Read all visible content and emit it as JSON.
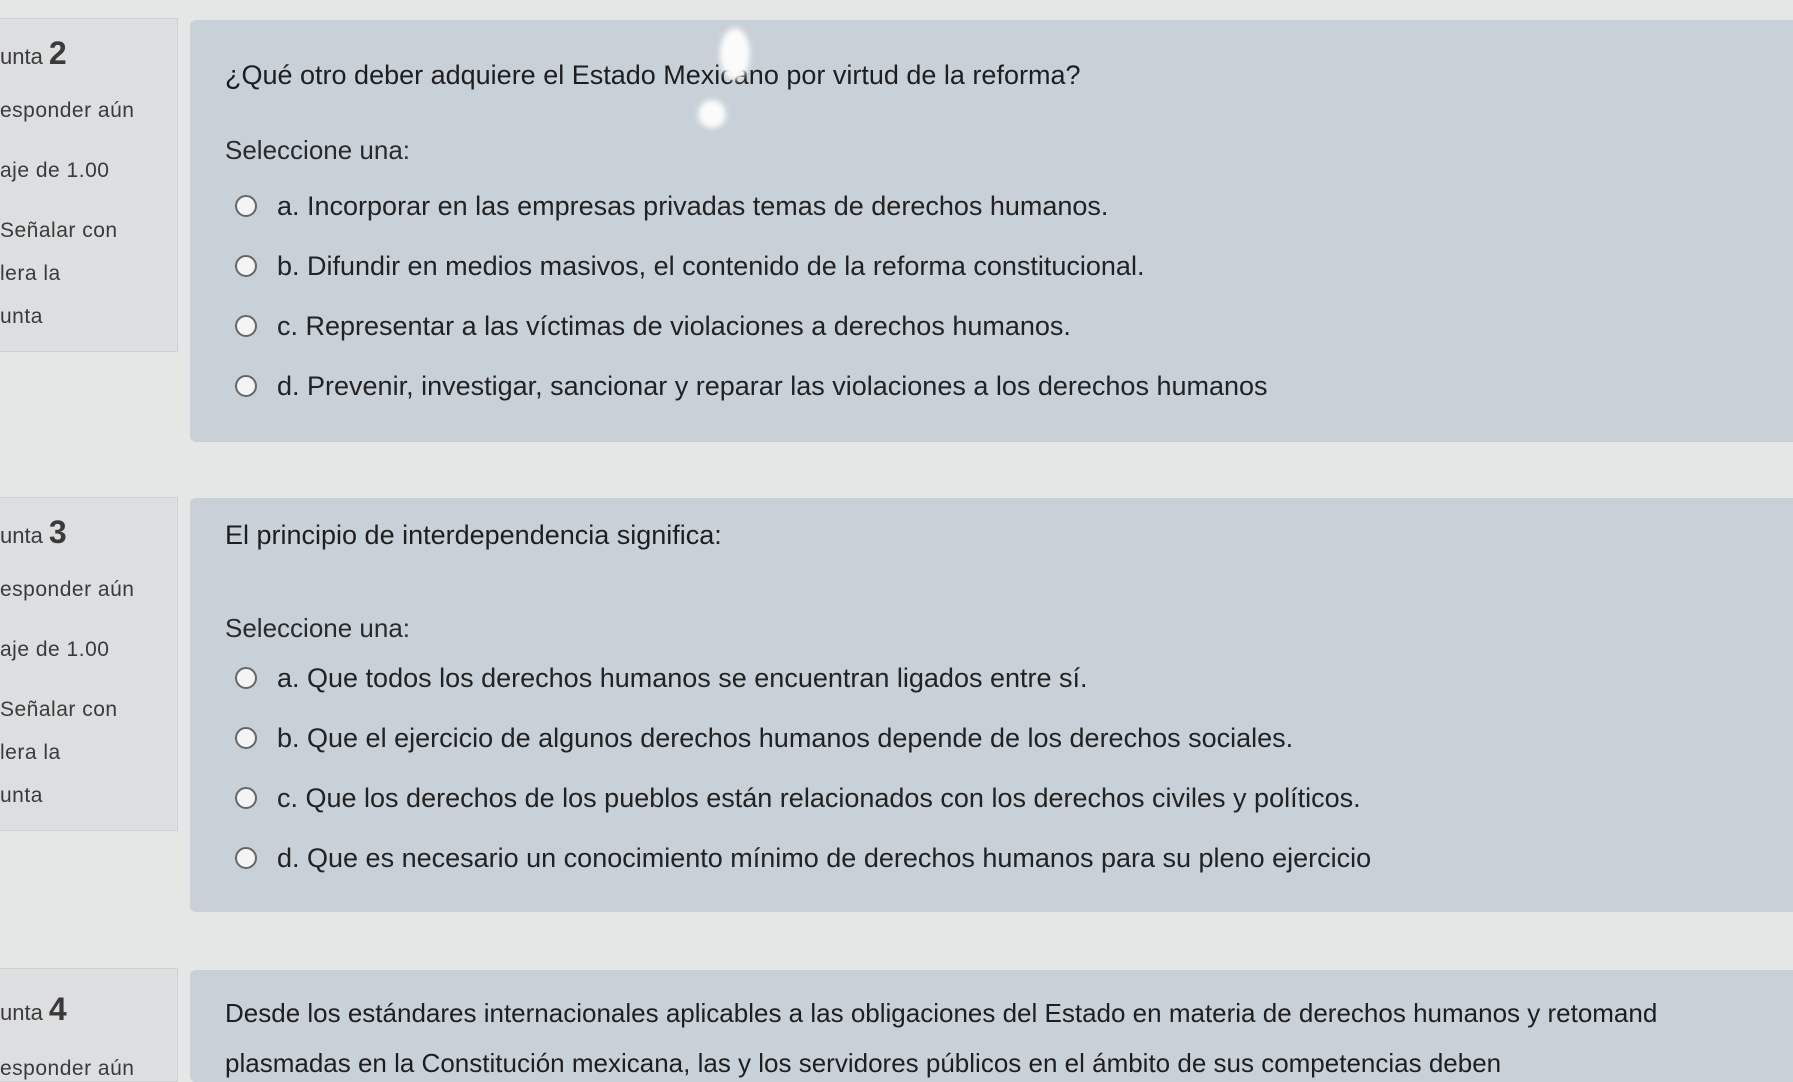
{
  "questions": [
    {
      "number_prefix": "unta",
      "number": "2",
      "status": "esponder aún",
      "grade": "aje de 1.00",
      "flag_line1": "Señalar con",
      "flag_line2": "lera la",
      "flag_line3": "unta",
      "text": "¿Qué otro deber adquiere el Estado Mexicano por virtud de la reforma?",
      "select_label": "Seleccione una:",
      "options": [
        "a. Incorporar en las empresas privadas temas de derechos humanos.",
        "b. Difundir en medios masivos, el contenido de la reforma constitucional.",
        "c. Representar a las víctimas de violaciones a derechos humanos.",
        "d. Prevenir, investigar, sancionar y reparar las violaciones a los derechos humanos"
      ]
    },
    {
      "number_prefix": "unta",
      "number": "3",
      "status": "esponder aún",
      "grade": "aje de 1.00",
      "flag_line1": "Señalar con",
      "flag_line2": "lera la",
      "flag_line3": "unta",
      "text": "El principio de interdependencia significa:",
      "select_label": "Seleccione una:",
      "options": [
        "a. Que todos los derechos humanos se encuentran ligados entre sí.",
        "b. Que el ejercicio de algunos derechos humanos depende de los derechos sociales.",
        "c. Que los derechos de los pueblos están relacionados con los derechos civiles y políticos.",
        "d. Que es necesario un conocimiento mínimo de derechos humanos para su pleno ejercicio"
      ]
    },
    {
      "number_prefix": "unta",
      "number": "4",
      "status": "esponder aún",
      "text_line1": "Desde los estándares internacionales aplicables a las obligaciones del Estado en materia de derechos humanos y retomand",
      "text_line2": "plasmadas en la Constitución mexicana, las y los servidores públicos en el ámbito de sus competencias deben"
    }
  ]
}
